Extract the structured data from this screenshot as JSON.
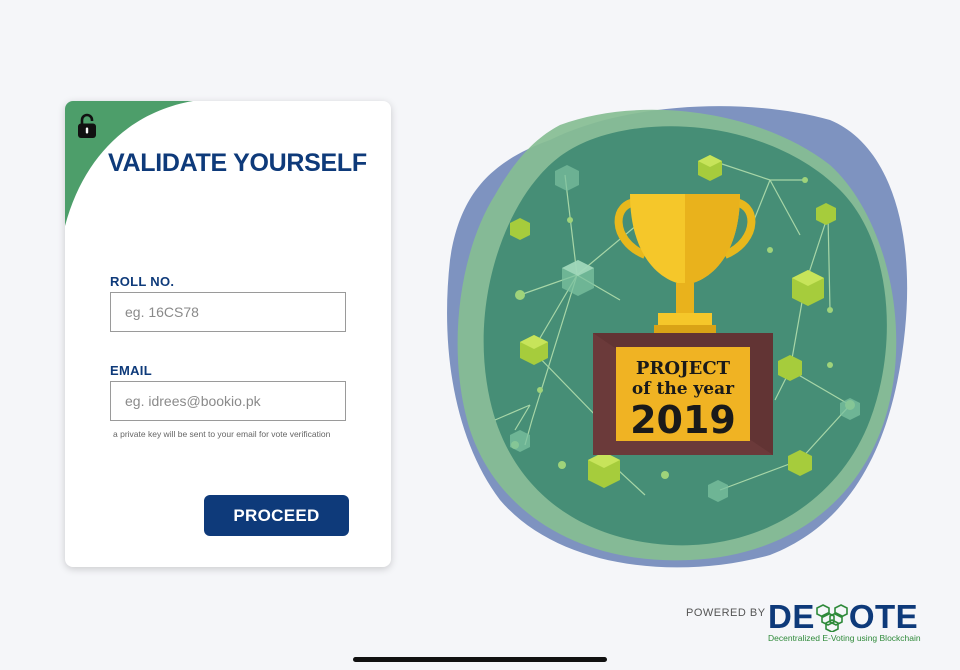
{
  "form": {
    "title": "VALIDATE YOURSELF",
    "roll_label": "ROLL NO.",
    "roll_placeholder": "eg. 16CS78",
    "email_label": "EMAIL",
    "email_placeholder": "eg. idrees@bookio.pk",
    "hint": "a private key will be sent to your email for vote verification",
    "proceed_label": "PROCEED",
    "lock_icon": "lock-icon"
  },
  "illustration": {
    "plaque_line1": "PROJECT",
    "plaque_line2": "of the year",
    "plaque_year": "2019"
  },
  "footer": {
    "powered_by": "POWERED BY",
    "brand_prefix": "DE",
    "brand_suffix": "OTE",
    "brand_tagline": "Decentralized E-Voting using Blockchain"
  },
  "colors": {
    "primary": "#0e3a7a",
    "accent_green": "#4d9e6a",
    "plaque_gold": "#f0b323"
  }
}
